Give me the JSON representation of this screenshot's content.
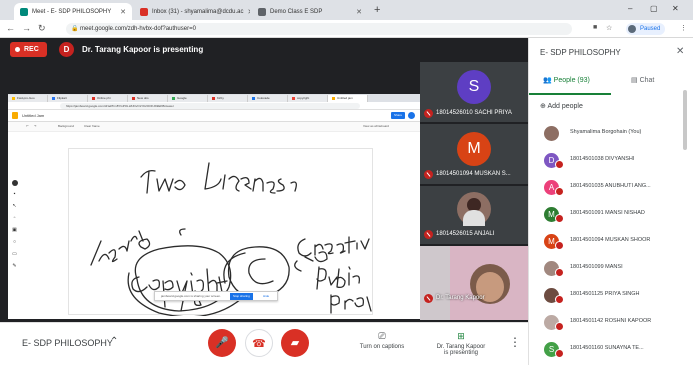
{
  "browser": {
    "tabs": [
      {
        "title": "Meet - E- SDP PHILOSOPHY",
        "favicon_color": "#00897b"
      },
      {
        "title": "Inbox (31) - shyamalima@dcdu.ac",
        "favicon_color": "#d93025"
      },
      {
        "title": "Demo Class E SDP",
        "favicon_color": "#5f6368"
      }
    ],
    "new_tab": "+",
    "window_controls": {
      "minimize": "–",
      "maximize": "▢",
      "close": "✕"
    },
    "url": "meet.google.com/zdh-hvbx-dof?authuser=0",
    "profile_status": "Paused"
  },
  "meet": {
    "rec_label": "REC",
    "presenter_initial": "D",
    "presenter_text": "Dr. Tarang Kapoor is presenting",
    "shared_screen": {
      "tabs": [
        "Fwd-pro-Goo",
        "Flipkart",
        "Online phi",
        "New obs",
        "Google",
        "Kirby",
        "Colocade",
        "copyright",
        "Untitled jam"
      ],
      "url": "https://jamboard.google.com/d/1ePhrv8YGPOLL8JOvOLYK2OOKJb9EKB/viewer",
      "app_title": "Untitled Jam",
      "share_button": "Share",
      "tool_left": "Background",
      "tool_clear": "Clear frame",
      "view_option": "View as whiteboard",
      "toast_text": "jamboard.google.com is sharing your screen.",
      "toast_stop": "Stop sharing",
      "toast_hide": "Hide"
    },
    "tiles": [
      {
        "initial": "S",
        "name": "18014526010 SACHI PRIYA",
        "avatar_color": "#5e3ec3"
      },
      {
        "initial": "M",
        "name": "18014501094 MUSKAN S...",
        "avatar_color": "#d84315"
      },
      {
        "initial": "",
        "name": "18014526015 ANJALI",
        "avatar_color": "#5d4037"
      },
      {
        "initial": "",
        "name": "Dr. Tarang Kapoor",
        "avatar_color": "#6d4c41"
      }
    ],
    "bottom": {
      "meeting_name": "E- SDP PHILOSOPHY",
      "captions": "Turn on captions",
      "presenting_line1": "Dr. Tarang Kapoor",
      "presenting_line2": "is presenting"
    },
    "panel": {
      "title": "E- SDP PHILOSOPHY",
      "people_tab": "People (93)",
      "chat_tab": "Chat",
      "add_people": "Add people",
      "participants": [
        {
          "initial": "",
          "name": "Shyamalima Borgohain (You)",
          "color": "#8d6e63",
          "muted": false
        },
        {
          "initial": "D",
          "name": "18014501038 DIVYANSHI",
          "color": "#7e57c2",
          "muted": true
        },
        {
          "initial": "A",
          "name": "18014501035 ANUBHUTI ANG...",
          "color": "#ec407a",
          "muted": true
        },
        {
          "initial": "M",
          "name": "18014501091 MANSI NISHAD",
          "color": "#2e7d32",
          "muted": true
        },
        {
          "initial": "M",
          "name": "18014501094 MUSKAN SHOOR",
          "color": "#d84315",
          "muted": true
        },
        {
          "initial": "",
          "name": "18014501099 MANSI",
          "color": "#a1887f",
          "muted": true
        },
        {
          "initial": "",
          "name": "18014501125 PRIYA SINGH",
          "color": "#6d4c41",
          "muted": true
        },
        {
          "initial": "",
          "name": "18014501142 ROSHNI KAPOOR",
          "color": "#bcaaa4",
          "muted": true
        },
        {
          "initial": "S",
          "name": "18014501160 SUNAYNA TE...",
          "color": "#43a047",
          "muted": true
        }
      ]
    }
  }
}
